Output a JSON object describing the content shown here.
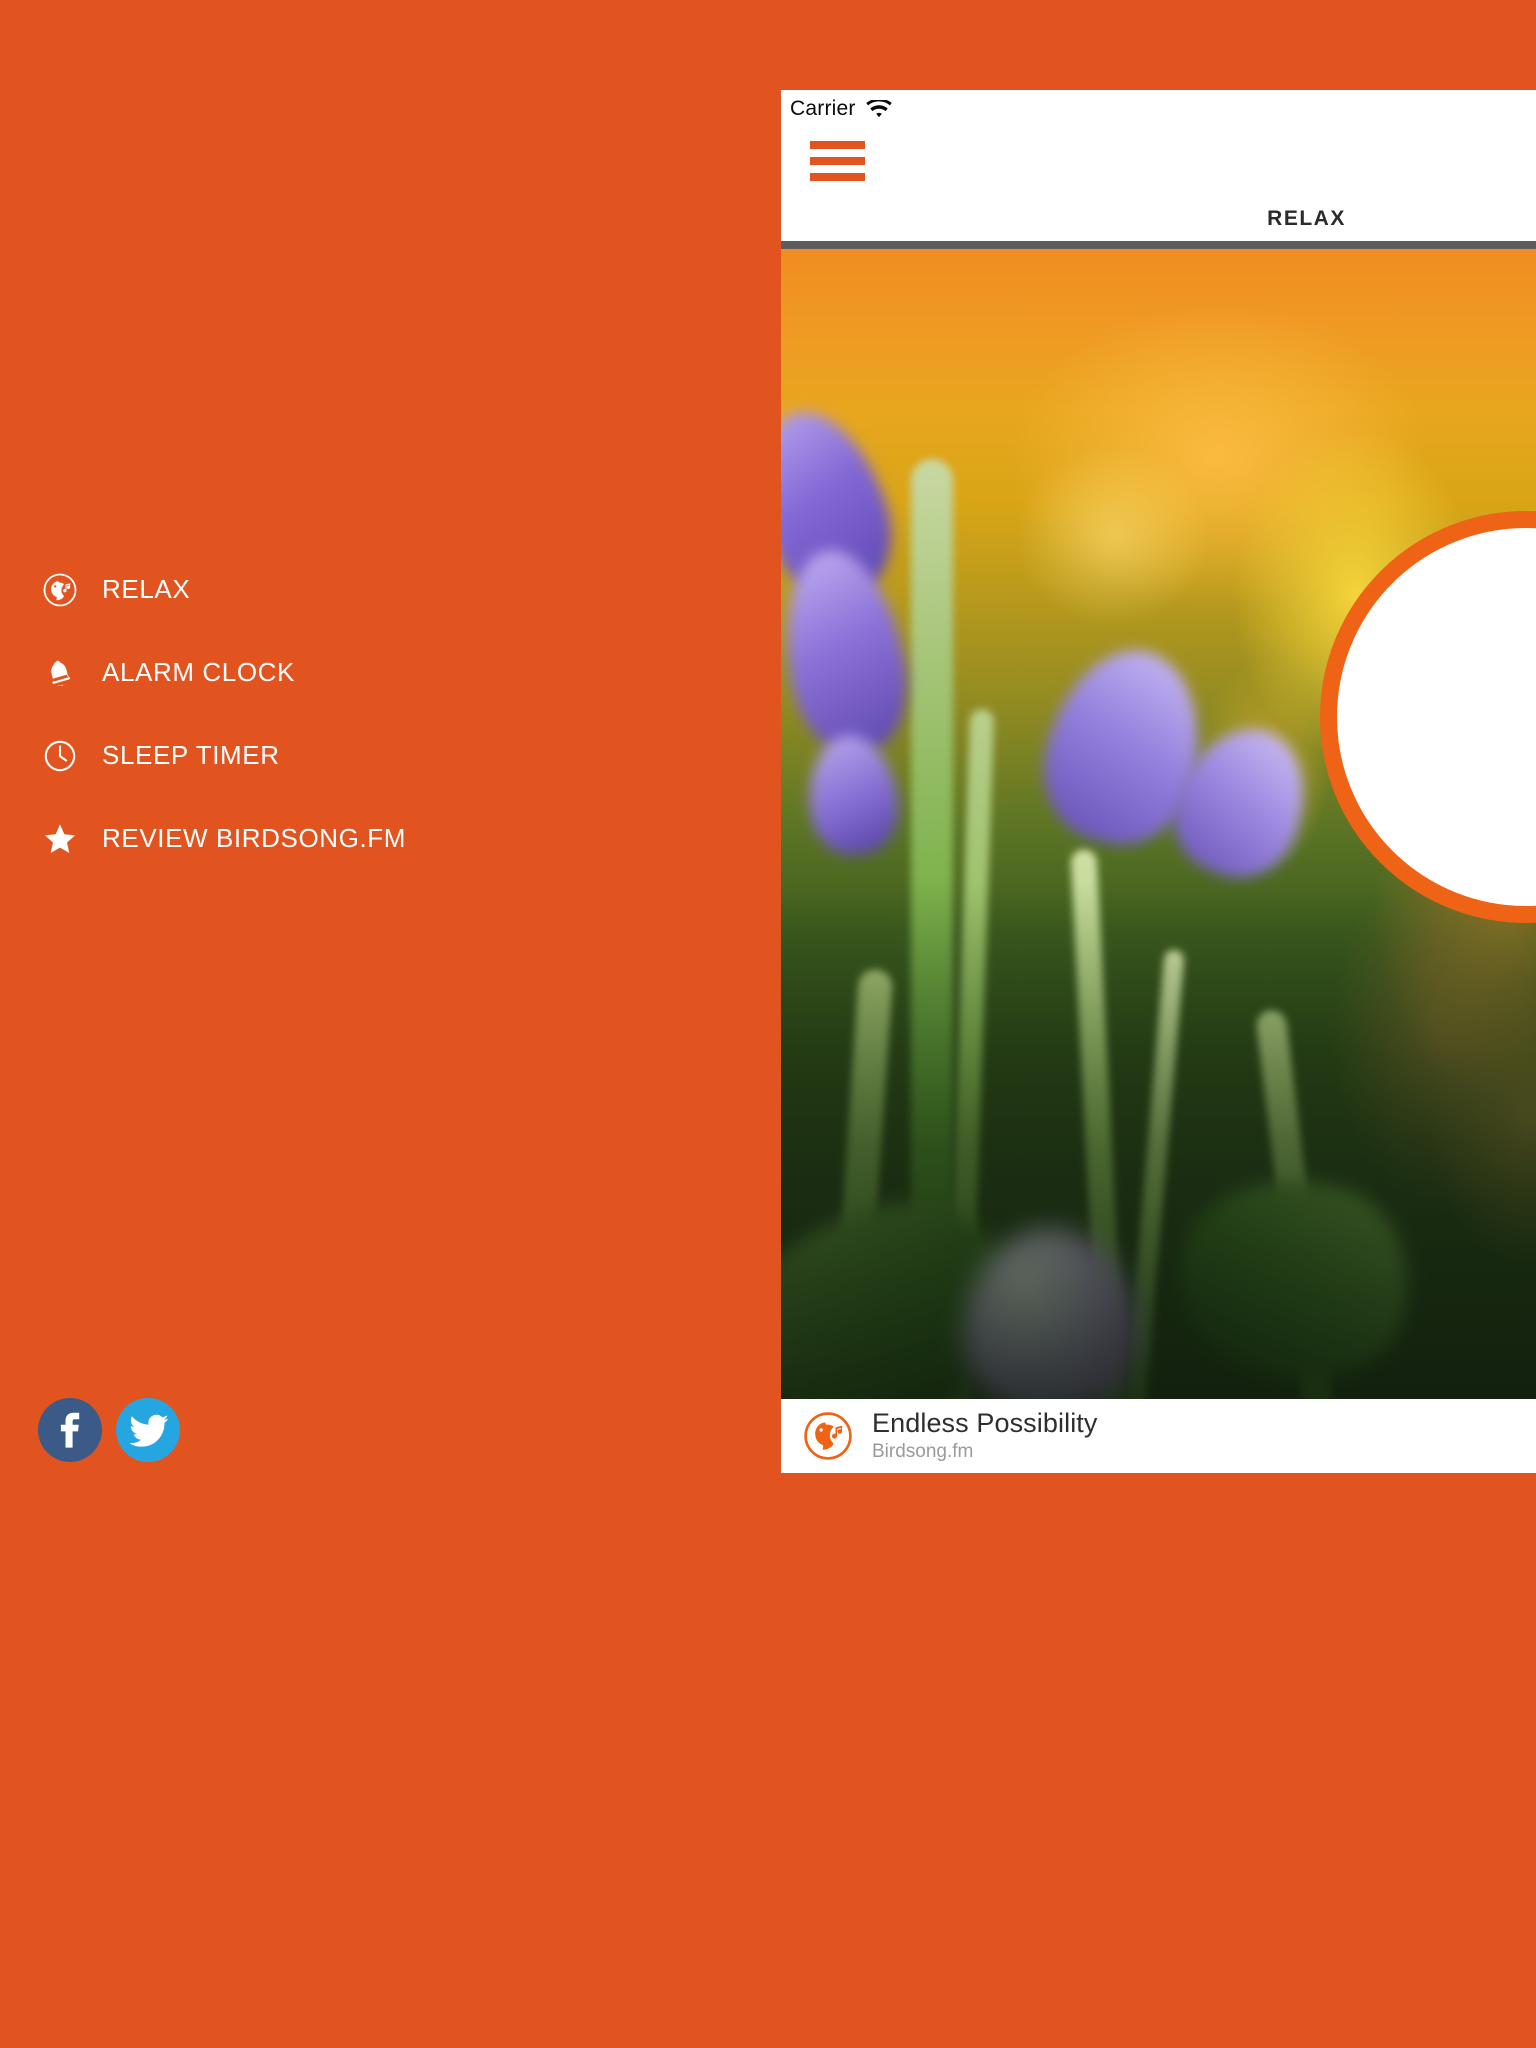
{
  "theme": {
    "brand_orange": "#e2541f",
    "ring_orange": "#ef6316",
    "facebook_blue": "#3b5a87",
    "twitter_blue": "#26a6e0",
    "divider_gray": "#5c5c5c",
    "menu_text": "#ffffff"
  },
  "drawer": {
    "items": [
      {
        "label": "RELAX",
        "icon": "bird-music-icon"
      },
      {
        "label": "ALARM CLOCK",
        "icon": "bell-icon"
      },
      {
        "label": "SLEEP TIMER",
        "icon": "clock-icon"
      },
      {
        "label": "REVIEW BIRDSONG.FM",
        "icon": "star-icon"
      }
    ],
    "social": [
      {
        "name": "facebook",
        "icon": "facebook-icon",
        "color": "#3b5a87"
      },
      {
        "name": "twitter",
        "icon": "twitter-icon",
        "color": "#26a6e0"
      }
    ]
  },
  "phone": {
    "status_bar": {
      "carrier": "Carrier",
      "wifi_icon": "wifi-icon"
    },
    "nav": {
      "menu_icon": "hamburger-menu-icon",
      "title": "RELAX"
    },
    "artwork": {
      "description": "blurred photo of purple bluebell flowers with golden bokeh background",
      "play_button_icon": "play-circle-icon"
    },
    "now_playing": {
      "logo_icon": "birdsong-logo-icon",
      "title": "Endless Possibility",
      "subtitle": "Birdsong.fm"
    }
  }
}
